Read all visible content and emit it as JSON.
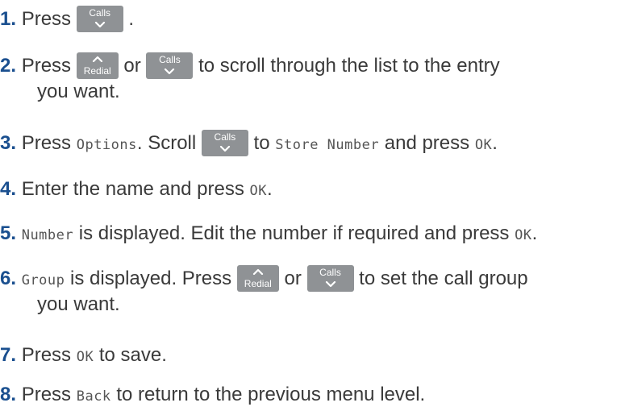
{
  "keys": {
    "calls": "Calls",
    "redial": "Redial"
  },
  "steps": [
    {
      "num": "1",
      "dot": ".",
      "a": " Press ",
      "b": " ."
    },
    {
      "num": "2",
      "dot": ".",
      "a": " Press ",
      "b": " or ",
      "c": " to scroll through the list to the entry",
      "d": "you want."
    },
    {
      "num": "3",
      "dot": ".",
      "a": " Press ",
      "lcd1": "Options",
      "b": ". Scroll ",
      "c": " to ",
      "lcd2": "Store Number",
      "d": " and press ",
      "lcd3": "OK",
      "e": "."
    },
    {
      "num": "4",
      "dot": ".",
      "a": " Enter the name and press ",
      "lcd1": "OK",
      "b": "."
    },
    {
      "num": "5",
      "dot": ".",
      "a": " ",
      "lcd1": "Number",
      "b": " is displayed. Edit the number if required and press ",
      "lcd2": "OK",
      "c": "."
    },
    {
      "num": "6",
      "dot": ".",
      "a": " ",
      "lcd1": "Group",
      "b": " is displayed. Press ",
      "c": " or ",
      "d": " to set the call group",
      "e": "you want."
    },
    {
      "num": "7",
      "dot": ".",
      "a": " Press ",
      "lcd1": "OK",
      "b": " to save."
    },
    {
      "num": "8",
      "dot": ".",
      "a": " Press ",
      "lcd1": "Back",
      "b": " to return to the previous menu level."
    }
  ]
}
